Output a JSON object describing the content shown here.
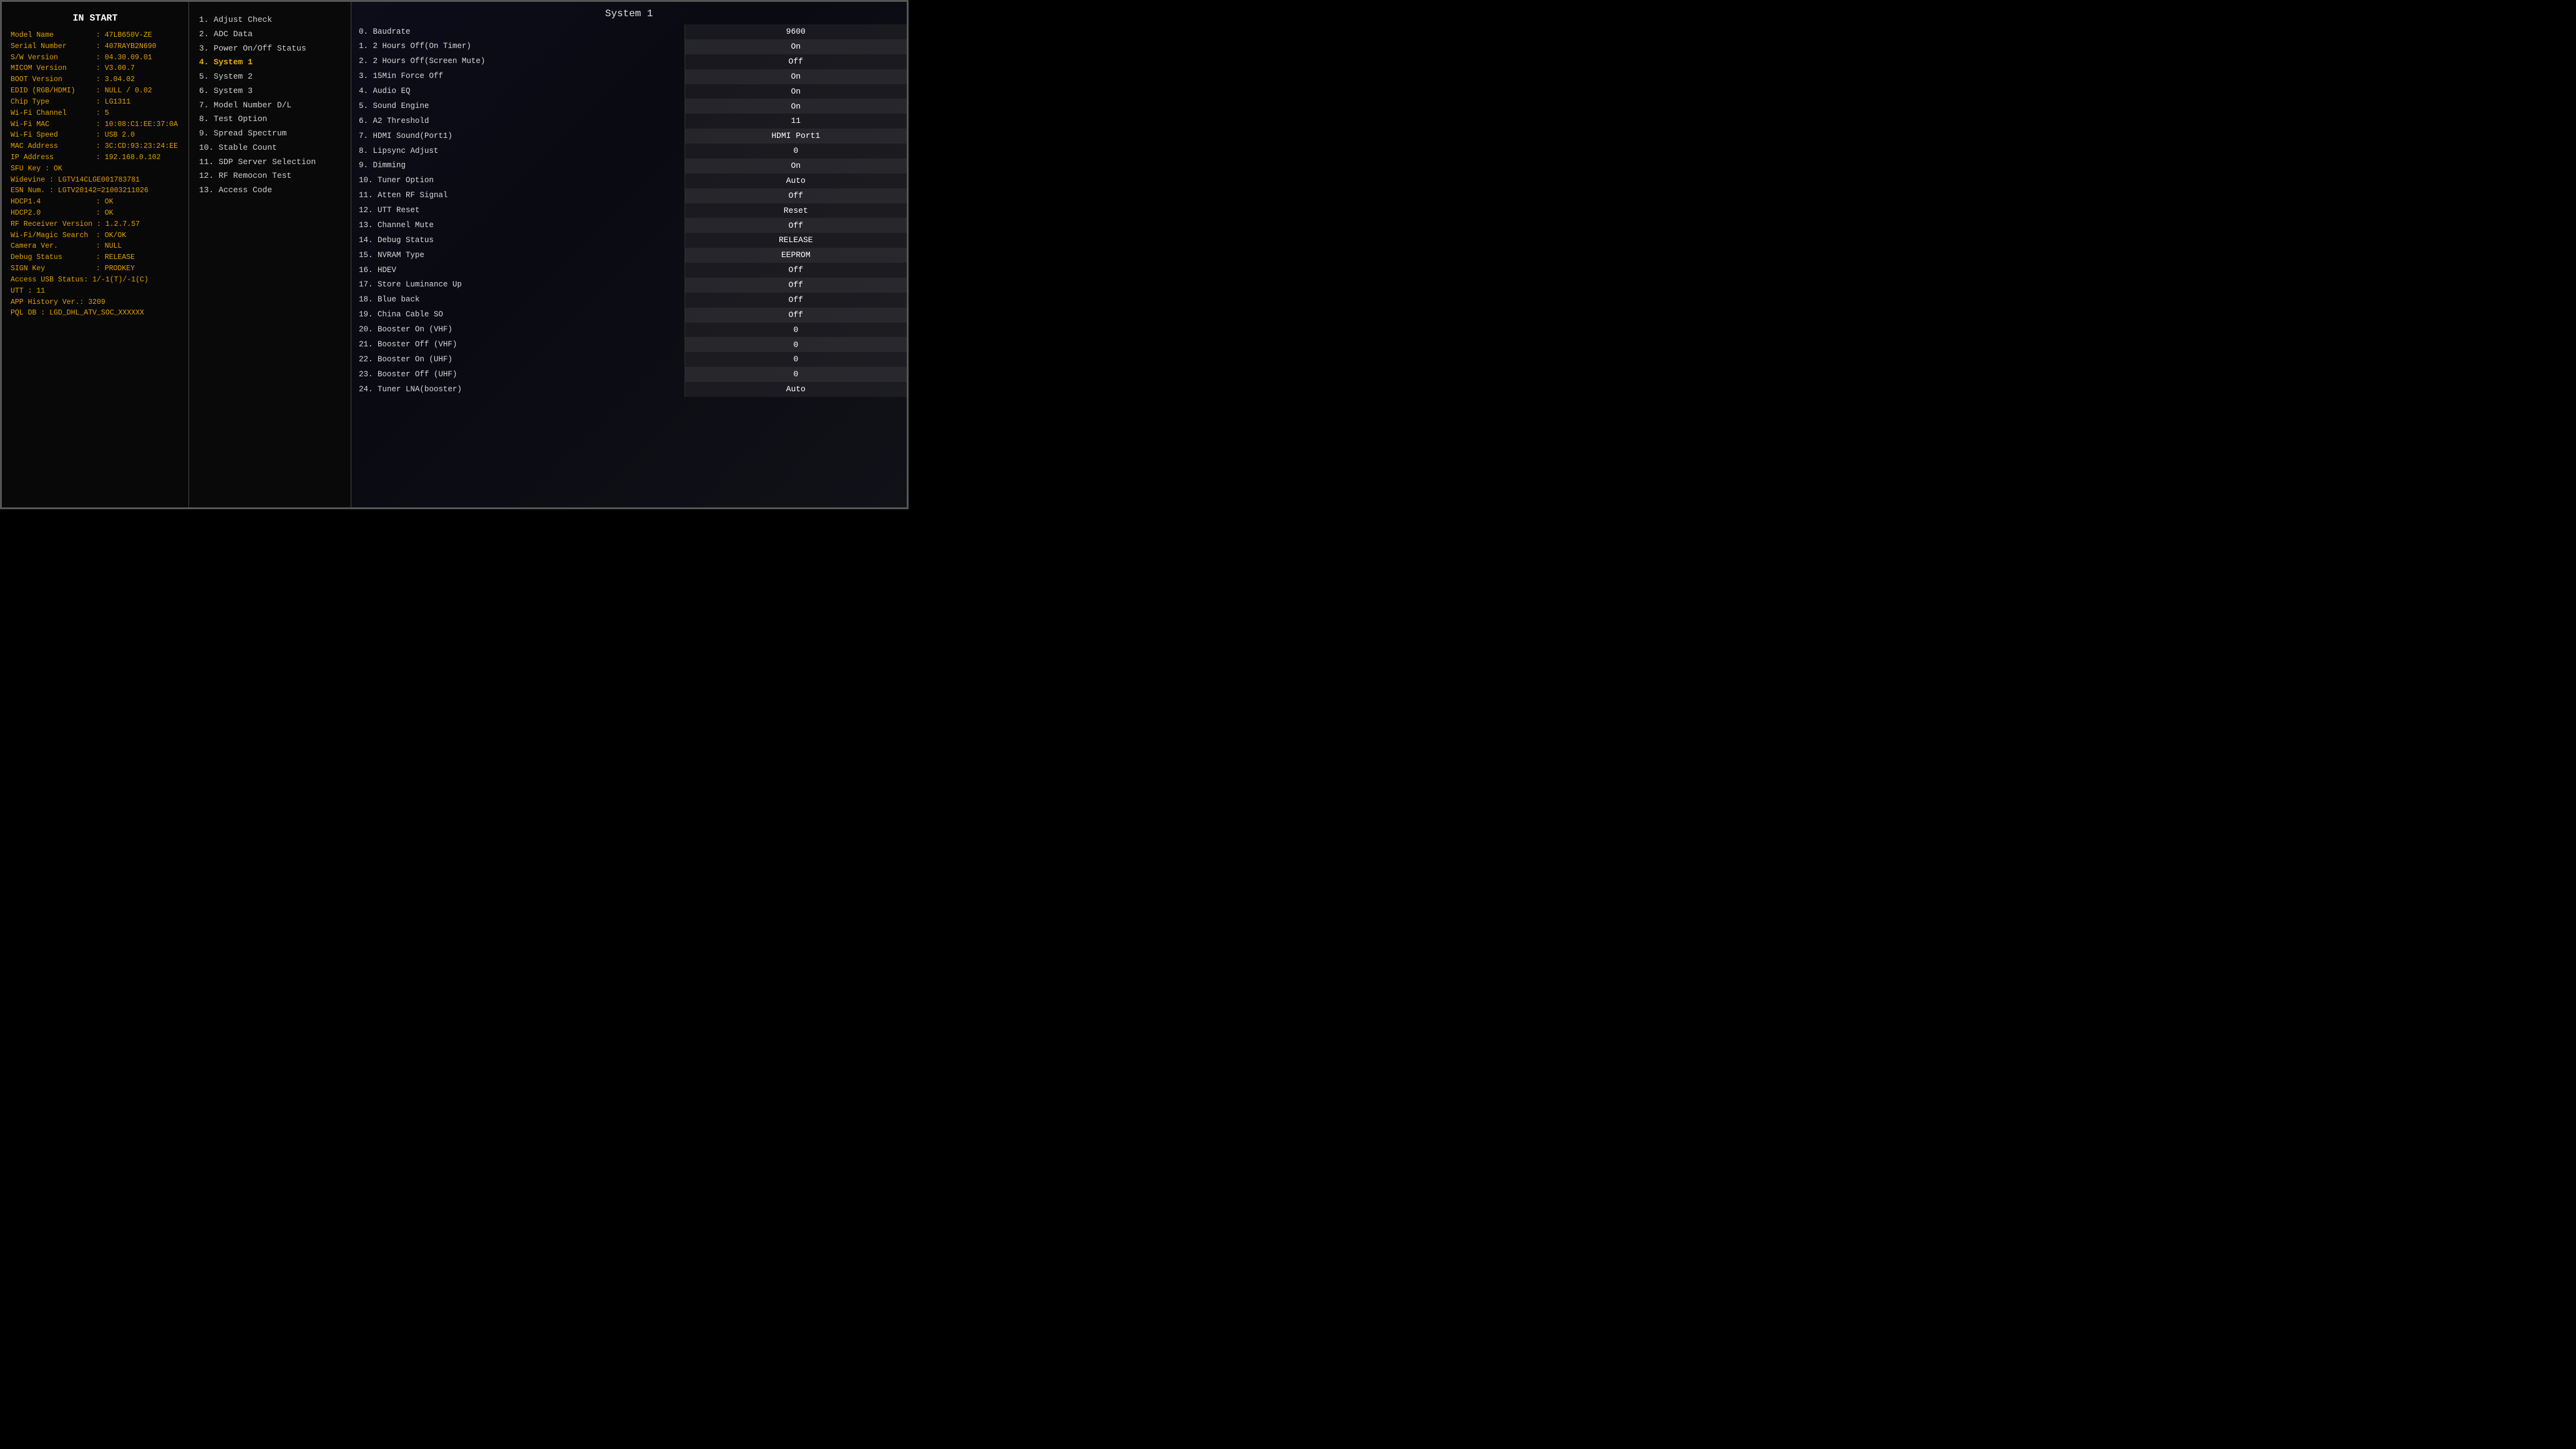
{
  "leftPanel": {
    "title": "IN START",
    "rows": [
      {
        "label": "Model Name",
        "value": ": 47LB650V-ZE"
      },
      {
        "label": "Serial Number",
        "value": ": 407RAYB2N690"
      },
      {
        "label": "S/W Version",
        "value": ": 04.30.09.01"
      },
      {
        "label": "MICOM Version",
        "value": ": V3.00.7"
      },
      {
        "label": "BOOT Version",
        "value": ": 3.04.02"
      },
      {
        "label": "EDID (RGB/HDMI)",
        "value": ": NULL / 0.02"
      },
      {
        "label": "Chip Type",
        "value": ": LG1311"
      },
      {
        "label": "Wi-Fi Channel",
        "value": ": 5"
      },
      {
        "label": "Wi-Fi MAC",
        "value": ": 10:08:C1:EE:37:0A"
      },
      {
        "label": "Wi-Fi Speed",
        "value": ": USB 2.0"
      },
      {
        "label": "MAC Address",
        "value": ": 3C:CD:93:23:24:EE"
      },
      {
        "label": "IP Address",
        "value": ": 192.168.0.102"
      }
    ],
    "singles": [
      "SFU Key : OK",
      "Widevine : LGTV14CLGE001783781",
      "ESN Num. : LGTV20142=21003211026"
    ],
    "hdcp": [
      {
        "label": "HDCP1.4",
        "value": ": OK"
      },
      {
        "label": "HDCP2.0",
        "value": ": OK"
      },
      {
        "label": "RF Receiver Version",
        "value": ": 1.2.7.57"
      },
      {
        "label": "Wi-Fi/Magic Search",
        "value": ": OK/OK"
      },
      {
        "label": "Camera Ver.",
        "value": ": NULL"
      },
      {
        "label": "Debug Status",
        "value": ": RELEASE"
      },
      {
        "label": "SIGN Key",
        "value": ": PRODKEY"
      }
    ],
    "bottom": [
      "Access USB Status: 1/-1(T)/-1(C)",
      "UTT : 11",
      "APP History Ver.: 3209",
      "PQL DB : LGD_DHL_ATV_SOC_XXXXXX"
    ]
  },
  "middlePanel": {
    "items": [
      {
        "num": "1",
        "label": ". Adjust Check",
        "active": false
      },
      {
        "num": "2",
        "label": ". ADC Data",
        "active": false
      },
      {
        "num": "3",
        "label": ". Power On/Off Status",
        "active": false
      },
      {
        "num": "4",
        "label": ". System 1",
        "active": true
      },
      {
        "num": "5",
        "label": ". System 2",
        "active": false
      },
      {
        "num": "6",
        "label": ". System 3",
        "active": false
      },
      {
        "num": "7",
        "label": ". Model Number D/L",
        "active": false
      },
      {
        "num": "8",
        "label": ". Test Option",
        "active": false
      },
      {
        "num": "9",
        "label": ". Spread Spectrum",
        "active": false
      },
      {
        "num": "10",
        "label": ". Stable Count",
        "active": false
      },
      {
        "num": "11",
        "label": ". SDP Server Selection",
        "active": false
      },
      {
        "num": "12",
        "label": ". RF Remocon Test",
        "active": false
      },
      {
        "num": "13",
        "label": ". Access Code",
        "active": false
      }
    ]
  },
  "rightPanel": {
    "title": "System 1",
    "rows": [
      {
        "label": "0. Baudrate",
        "value": "9600"
      },
      {
        "label": "1. 2 Hours Off(On Timer)",
        "value": "On"
      },
      {
        "label": "2. 2 Hours Off(Screen Mute)",
        "value": "Off"
      },
      {
        "label": "3. 15Min Force Off",
        "value": "On"
      },
      {
        "label": "4. Audio EQ",
        "value": "On"
      },
      {
        "label": "5. Sound Engine",
        "value": "On"
      },
      {
        "label": "6. A2 Threshold",
        "value": "11"
      },
      {
        "label": "7. HDMI Sound(Port1)",
        "value": "HDMI Port1"
      },
      {
        "label": "8. Lipsync Adjust",
        "value": "0"
      },
      {
        "label": "9. Dimming",
        "value": "On"
      },
      {
        "label": "10. Tuner Option",
        "value": "Auto"
      },
      {
        "label": "11. Atten RF Signal",
        "value": "Off"
      },
      {
        "label": "12. UTT Reset",
        "value": "Reset"
      },
      {
        "label": "13. Channel Mute",
        "value": "Off"
      },
      {
        "label": "14. Debug Status",
        "value": "RELEASE"
      },
      {
        "label": "15. NVRAM Type",
        "value": "EEPROM"
      },
      {
        "label": "16. HDEV",
        "value": "Off"
      },
      {
        "label": "17. Store Luminance Up",
        "value": "Off"
      },
      {
        "label": "18. Blue back",
        "value": "Off"
      },
      {
        "label": "19. China Cable SO",
        "value": "Off"
      },
      {
        "label": "20. Booster On (VHF)",
        "value": "0"
      },
      {
        "label": "21. Booster Off (VHF)",
        "value": "0"
      },
      {
        "label": "22. Booster On (UHF)",
        "value": "0"
      },
      {
        "label": "23. Booster Off (UHF)",
        "value": "0"
      },
      {
        "label": "24. Tuner LNA(booster)",
        "value": "Auto"
      }
    ]
  }
}
